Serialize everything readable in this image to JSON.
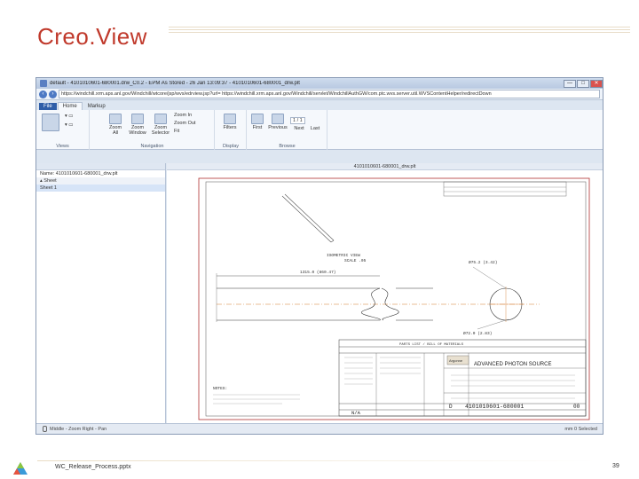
{
  "slide": {
    "title": "Creo.View",
    "footer_filename": "WC_Release_Process.pptx",
    "page_number": "39"
  },
  "window": {
    "title": "default - 4101010601-680001.drw_C0.2 - EPM As Stored - 26 Jan 13:09:37 - 4101010601-680001_drw.plt",
    "url": "https://windchill.xrm.aps.anl.gov/Windchill/wtcore/jsp/wvs/edrview.jsp?url= https://windchill.xrm.aps.anl.gov/Windchill/servlet/WindchillAuthGW/com.ptc.wvs.server.util.WVSContentHelper/redirectDown",
    "buttons": [
      "—",
      "□",
      "✕"
    ]
  },
  "ribbon": {
    "tabs": [
      "File",
      "Home",
      "Markup"
    ],
    "groups": {
      "views": "Views",
      "navigation": "Navigation",
      "display": "Display",
      "browse": "Browse"
    },
    "zoom_all": "Zoom All",
    "zoom_window": "Zoom Window",
    "zoom_selector": "Zoom Selector",
    "zoom_in": "Zoom In",
    "zoom_out": "Zoom Out",
    "fit": "Fit",
    "filters": "Filters",
    "first": "First",
    "previous": "Previous",
    "page_box": "1 / 1",
    "next": "Next",
    "last": "Last"
  },
  "side_panel": {
    "name_label": "Name: 4101010601-680001_drw.plt",
    "group": "Sheet",
    "items": [
      "Sheet 1"
    ]
  },
  "viewer": {
    "title": "4101010601-680001_drw.plt",
    "dim_length": "1315.0 (860.47)",
    "dim_diameter": "Ø75.2 (3.42)",
    "dim_bottom": "Ø72.0 (2.83)",
    "iso_note": "ISOMETRIC VIEW\nSCALE .05",
    "parts_list": "PARTS LIST / BILL OF MATERIALS",
    "company": "ADVANCED PHOTON SOURCE",
    "drawing_number": "4101010601-680001",
    "rev": "00",
    "notes_header": "NOTES:",
    "size": "D",
    "scale_block": "N/A"
  },
  "status_bar": {
    "text": "Middle - Zoom  Right - Pan",
    "right": "mm  0 Selected"
  }
}
